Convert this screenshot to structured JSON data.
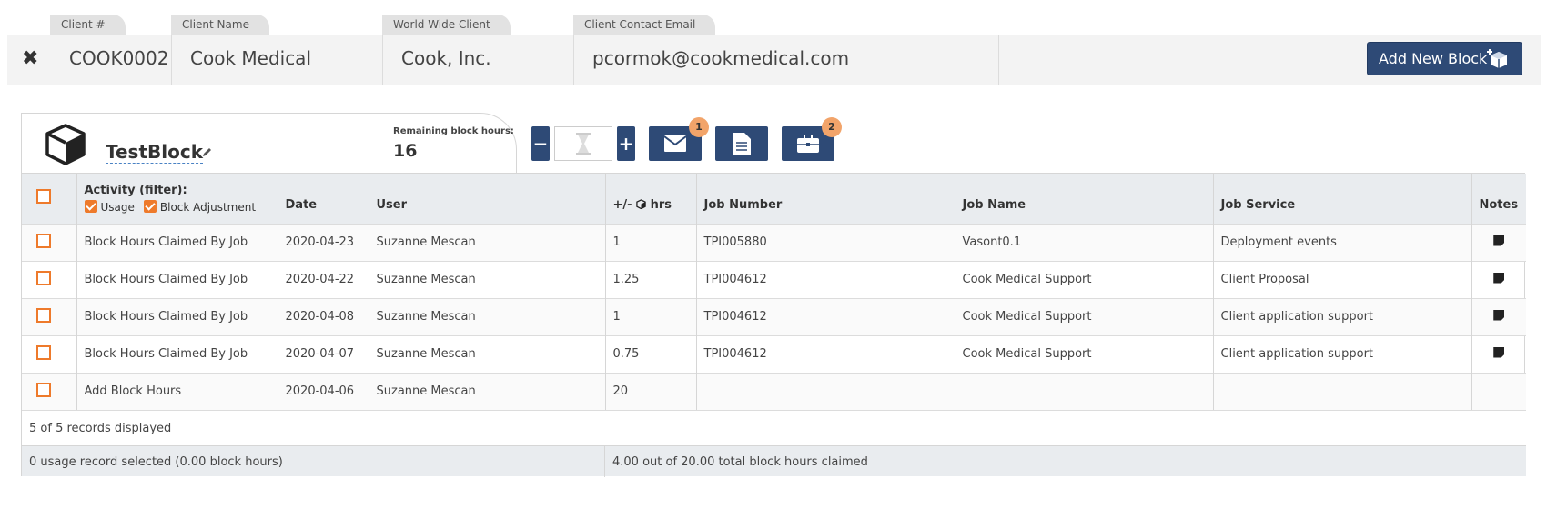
{
  "header": {
    "close": "✖",
    "client_num_label": "Client #",
    "client_num": "COOK0002",
    "client_name_label": "Client Name",
    "client_name": "Cook Medical",
    "ww_client_label": "World Wide Client",
    "ww_client": "Cook, Inc.",
    "email_label": "Client Contact Email",
    "email": "pcormok@cookmedical.com",
    "add_block_label": "Add New Block"
  },
  "block": {
    "name": "TestBlock",
    "remaining_label": "Remaining block hours:",
    "remaining": "16"
  },
  "actions": {
    "minus": "−",
    "plus": "+",
    "email_badge": "1",
    "briefcase_badge": "2"
  },
  "table": {
    "headers": {
      "activity": "Activity (filter):",
      "filter_usage": "Usage",
      "filter_adjustment": "Block Adjustment",
      "date": "Date",
      "user": "User",
      "hrs_prefix": "+/-",
      "hrs_suffix": "hrs",
      "job_number": "Job Number",
      "job_name": "Job Name",
      "job_service": "Job Service",
      "notes": "Notes"
    },
    "rows": [
      {
        "activity": "Block Hours Claimed By Job",
        "date": "2020-04-23",
        "user": "Suzanne Mescan",
        "hrs": "1",
        "job_number": "TPI005880",
        "job_name": "Vasont0.1",
        "job_service": "Deployment events"
      },
      {
        "activity": "Block Hours Claimed By Job",
        "date": "2020-04-22",
        "user": "Suzanne Mescan",
        "hrs": "1.25",
        "job_number": "TPI004612",
        "job_name": "Cook Medical Support",
        "job_service": "Client Proposal"
      },
      {
        "activity": "Block Hours Claimed By Job",
        "date": "2020-04-08",
        "user": "Suzanne Mescan",
        "hrs": "1",
        "job_number": "TPI004612",
        "job_name": "Cook Medical Support",
        "job_service": "Client application support"
      },
      {
        "activity": "Block Hours Claimed By Job",
        "date": "2020-04-07",
        "user": "Suzanne Mescan",
        "hrs": "0.75",
        "job_number": "TPI004612",
        "job_name": "Cook Medical Support",
        "job_service": "Client application support"
      },
      {
        "activity": "Add Block Hours",
        "date": "2020-04-06",
        "user": "Suzanne Mescan",
        "hrs": "20",
        "job_number": "",
        "job_name": "",
        "job_service": ""
      }
    ],
    "records_displayed": "5 of 5 records displayed",
    "selected_summary": "0 usage record selected (0.00 block hours)",
    "claimed_summary": "4.00 out of 20.00 total block hours claimed"
  },
  "colors": {
    "primary": "#2e4a76",
    "checkbox": "#ee7a2b",
    "badge": "#f2a46a"
  }
}
